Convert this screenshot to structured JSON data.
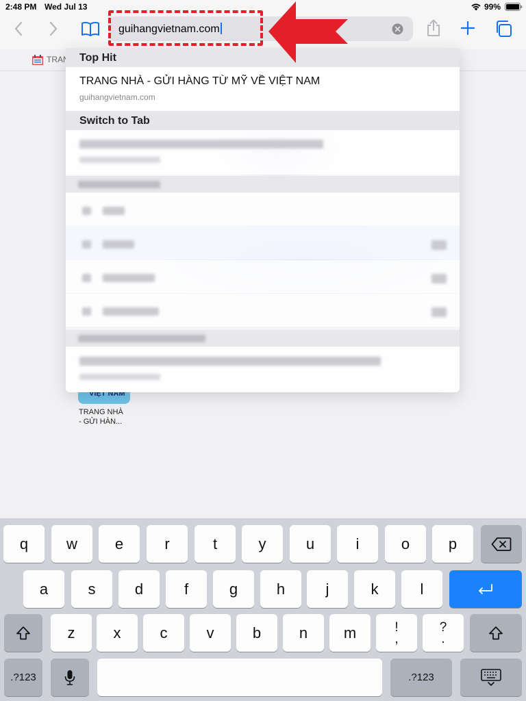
{
  "status": {
    "time": "2:48 PM",
    "date": "Wed Jul 13",
    "battery": "99%"
  },
  "url_bar": {
    "value": "guihangvietnam.com"
  },
  "favorites": {
    "item": "TRAN"
  },
  "dropdown": {
    "top_hit_header": "Top Hit",
    "top_hit_title": "TRANG NHÀ - GỬI HÀNG TỪ MỸ VỀ VIỆT NAM",
    "top_hit_url": "guihangvietnam.com",
    "switch_tab_header": "Switch to Tab"
  },
  "tile": {
    "image_text": "VIỆT NAM",
    "label_line1": "TRANG NHÀ",
    "label_line2": "- GỬI HÀN..."
  },
  "keyboard": {
    "row1": [
      "q",
      "w",
      "e",
      "r",
      "t",
      "y",
      "u",
      "i",
      "o",
      "p"
    ],
    "row2": [
      "a",
      "s",
      "d",
      "f",
      "g",
      "h",
      "j",
      "k",
      "l"
    ],
    "row3": [
      "z",
      "x",
      "c",
      "v",
      "b",
      "n",
      "m"
    ],
    "punct1_top": "!",
    "punct1_bottom": ",",
    "punct2_top": "?",
    "punct2_bottom": ".",
    "numbers_left": ".?123",
    "numbers_right": ".?123"
  },
  "colors": {
    "accent": "#1a82fb",
    "highlight": "#e0202b"
  }
}
